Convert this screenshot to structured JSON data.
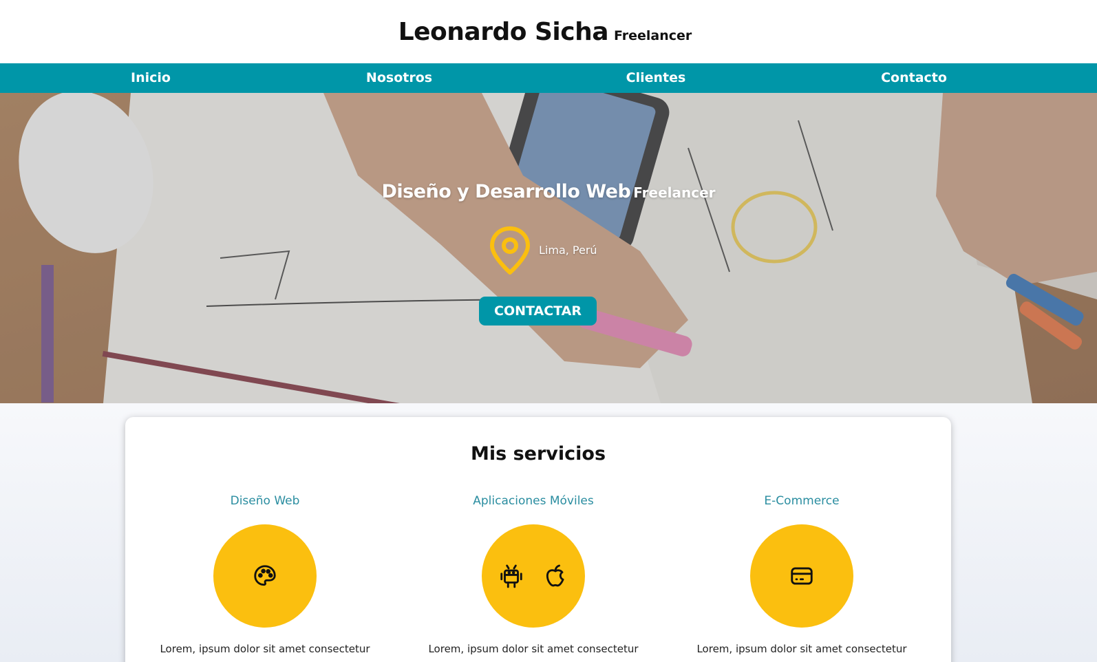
{
  "header": {
    "title": "Leonardo Sicha",
    "subtitle": "Freelancer"
  },
  "nav": {
    "items": [
      {
        "label": "Inicio"
      },
      {
        "label": "Nosotros"
      },
      {
        "label": "Clientes"
      },
      {
        "label": "Contacto"
      }
    ]
  },
  "hero": {
    "title": "Diseño y Desarrollo Web",
    "subtitle": "Freelancer",
    "location_icon": "map-pin-icon",
    "location": "Lima, Perú",
    "cta_label": "CONTACTAR"
  },
  "services": {
    "heading": "Mis servicios",
    "items": [
      {
        "title": "Diseño Web",
        "icons": [
          "palette-icon"
        ],
        "description": "Lorem, ipsum dolor sit amet consectetur"
      },
      {
        "title": "Aplicaciones Móviles",
        "icons": [
          "android-icon",
          "apple-icon"
        ],
        "description": "Lorem, ipsum dolor sit amet consectetur"
      },
      {
        "title": "E-Commerce",
        "icons": [
          "credit-card-icon"
        ],
        "description": "Lorem, ipsum dolor sit amet consectetur"
      }
    ]
  },
  "colors": {
    "primary": "#0096a8",
    "accent": "#fbbf0f",
    "service_title": "#2a8da0"
  }
}
